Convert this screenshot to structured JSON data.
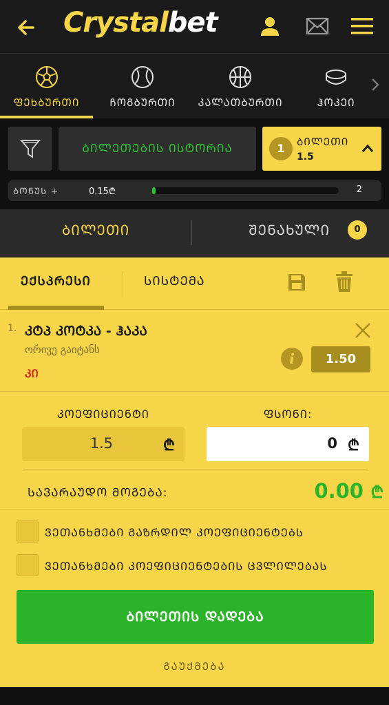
{
  "header": {
    "logo_part1": "Crystal",
    "logo_part2": "bet",
    "accent": "#f7d548"
  },
  "sports": [
    {
      "label": "ᲤᲔᲮᲑᲣᲠᲗᲘ",
      "icon": "soccer-ball-icon",
      "active": true
    },
    {
      "label": "ᲩᲝᲒᲑᲣᲠᲗᲘ",
      "icon": "tennis-ball-icon",
      "active": false
    },
    {
      "label": "ᲙᲐᲚᲐᲗᲑᲣᲠᲗᲘ",
      "icon": "basketball-icon",
      "active": false
    },
    {
      "label": "ᲰᲝᲙᲔᲘ",
      "icon": "hockey-puck-icon",
      "active": false
    }
  ],
  "controls": {
    "history_label": "ᲑᲘᲚᲔᲗᲔᲑᲘᲡ ᲘᲡᲢᲝᲠᲘᲐ",
    "ticket_count": "1",
    "ticket_label": "ᲑᲘᲚᲔᲗᲘ",
    "ticket_odd": "1.5"
  },
  "bonus": {
    "label": "ᲑᲝᲜᲣᲡ +",
    "value": "0.15₾",
    "max": "2",
    "progress_fraction": 0.02
  },
  "tabs": {
    "ticket": "ᲑᲘᲚᲔᲗᲘ",
    "saved": "ᲨᲔᲜᲐᲮᲣᲚᲘ",
    "saved_count": "0"
  },
  "slip": {
    "express": "ᲔᲥᲡᲞᲠᲔᲡᲘ",
    "system": "ᲡᲘᲡᲢᲔᲛᲐ",
    "event": {
      "index": "1.",
      "name": "ᲙᲢᲞ ᲙᲝᲢᲙᲐ - ᲰᲐᲙᲐ",
      "selection": "ორივე გაიტანს",
      "market": "ᲙᲘ",
      "odd": "1.50"
    },
    "coef_label": "ᲙᲝᲔᲤᲘᲪᲘᲔᲜᲢᲘ",
    "coef_value": "1.5",
    "stake_label": "ᲤᲡᲝᲜᲘ:",
    "stake_value": "0",
    "currency": "₾",
    "win_label": "ᲡᲐᲕᲐᲠᲐᲣᲓᲝ ᲛᲝᲒᲔᲑᲐ:",
    "win_value": "0.00",
    "check1": "ᲕᲔᲗᲐᲜᲮᲛᲔᲑᲘ ᲒᲐᲖᲠᲓᲘᲚ ᲙᲝᲔᲤᲘᲪᲘᲔᲜᲢᲔᲑᲡ",
    "check2": "ᲕᲔᲗᲐᲜᲮᲛᲔᲑᲘ ᲙᲝᲔᲤᲘᲪᲘᲔᲜᲢᲔᲑᲘᲡ ᲪᲕᲚᲘᲚᲔᲑᲐᲡ",
    "place_label": "ᲑᲘᲚᲔᲗᲘᲡ ᲓᲐᲓᲔᲑᲐ",
    "cancel_label": "ᲒᲐᲣᲥᲛᲔᲑᲐ"
  }
}
